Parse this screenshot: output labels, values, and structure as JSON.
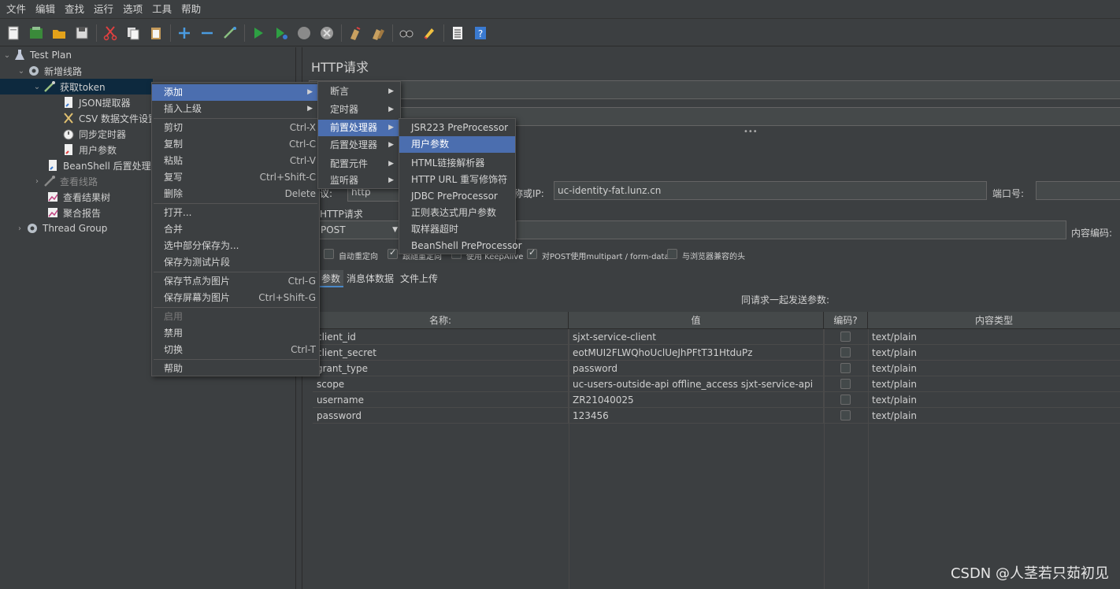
{
  "menubar": [
    "文件",
    "编辑",
    "查找",
    "运行",
    "选项",
    "工具",
    "帮助"
  ],
  "toolbar_icons": [
    "new-icon",
    "templates-icon",
    "open-icon",
    "save-icon",
    "cut-icon",
    "copy-icon",
    "paste-icon",
    "expand-icon",
    "collapse-icon",
    "toggle-icon",
    "start-icon",
    "start-no-pause-icon",
    "stop-icon",
    "shutdown-icon",
    "clear-icon",
    "clear-all-icon",
    "search-icon",
    "reset-search-icon",
    "function-helper-icon",
    "help-icon"
  ],
  "tree": [
    {
      "label": "Test Plan",
      "icon": "flask-icon"
    },
    {
      "label": "新增线路",
      "icon": "gear-icon"
    },
    {
      "label": "获取token",
      "icon": "pipette-icon"
    },
    {
      "label": "JSON提取器",
      "icon": "doc-icon"
    },
    {
      "label": "CSV 数据文件设置",
      "icon": "scissors-icon"
    },
    {
      "label": "同步定时器",
      "icon": "timer-icon"
    },
    {
      "label": "用户参数",
      "icon": "doc-icon"
    },
    {
      "label": "BeanShell 后置处理程序",
      "icon": "doc-icon"
    },
    {
      "label": "查看线路",
      "icon": "pipette-icon"
    },
    {
      "label": "查看结果树",
      "icon": "chart-icon"
    },
    {
      "label": "聚合报告",
      "icon": "chart-icon"
    },
    {
      "label": "Thread Group",
      "icon": "gear-icon"
    }
  ],
  "main": {
    "title": "HTTP请求",
    "protocol_label": "议:",
    "protocol_value": "http",
    "server_label": "称或IP:",
    "server_value": "uc-identity-fat.lunz.cn",
    "port_label": "端口号:",
    "http_request_label": "HTTP请求",
    "method": "POST",
    "encoding_label": "内容编码:",
    "checkboxes": [
      {
        "label": "自动重定向",
        "checked": false
      },
      {
        "label": "跟随重定向",
        "checked": true
      },
      {
        "label": "使用 KeepAlive",
        "checked": true
      },
      {
        "label": "对POST使用multipart / form-data",
        "checked": true
      },
      {
        "label": "与浏览器兼容的头",
        "checked": false
      }
    ],
    "tabs": [
      "参数",
      "消息体数据",
      "文件上传"
    ],
    "params_caption": "同请求一起发送参数:",
    "columns": [
      "名称:",
      "值",
      "编码?",
      "内容类型"
    ],
    "rows": [
      {
        "name": "client_id",
        "value": "sjxt-service-client",
        "type": "text/plain"
      },
      {
        "name": "client_secret",
        "value": "eotMUI2FLWQhoUclUeJhPFtT31HtduPz",
        "type": "text/plain"
      },
      {
        "name": "grant_type",
        "value": "password",
        "type": "text/plain"
      },
      {
        "name": "scope",
        "value": "uc-users-outside-api offline_access sjxt-service-api",
        "type": "text/plain"
      },
      {
        "name": "username",
        "value": "ZR21040025",
        "type": "text/plain"
      },
      {
        "name": "password",
        "value": "123456",
        "type": "text/plain"
      }
    ]
  },
  "context_menu": {
    "items": [
      {
        "label": "添加",
        "submenu": true
      },
      {
        "label": "插入上级",
        "submenu": true
      },
      {
        "label": "剪切",
        "shortcut": "Ctrl-X"
      },
      {
        "label": "复制",
        "shortcut": "Ctrl-C"
      },
      {
        "label": "粘贴",
        "shortcut": "Ctrl-V"
      },
      {
        "label": "复写",
        "shortcut": "Ctrl+Shift-C"
      },
      {
        "label": "删除",
        "shortcut": "Delete"
      },
      {
        "label": "打开..."
      },
      {
        "label": "合并"
      },
      {
        "label": "选中部分保存为..."
      },
      {
        "label": "保存为测试片段"
      },
      {
        "label": "保存节点为图片",
        "shortcut": "Ctrl-G"
      },
      {
        "label": "保存屏幕为图片",
        "shortcut": "Ctrl+Shift-G"
      },
      {
        "label": "启用"
      },
      {
        "label": "禁用"
      },
      {
        "label": "切换",
        "shortcut": "Ctrl-T"
      },
      {
        "label": "帮助"
      }
    ]
  },
  "add_submenu": [
    "断言",
    "定时器",
    "前置处理器",
    "后置处理器",
    "配置元件",
    "监听器"
  ],
  "preprocessor_submenu": [
    "JSR223 PreProcessor",
    "用户参数",
    "HTML链接解析器",
    "HTTP URL 重写修饰符",
    "JDBC PreProcessor",
    "正则表达式用户参数",
    "取样器超时",
    "BeanShell PreProcessor"
  ],
  "watermark": "CSDN @人茎若只茹初见"
}
